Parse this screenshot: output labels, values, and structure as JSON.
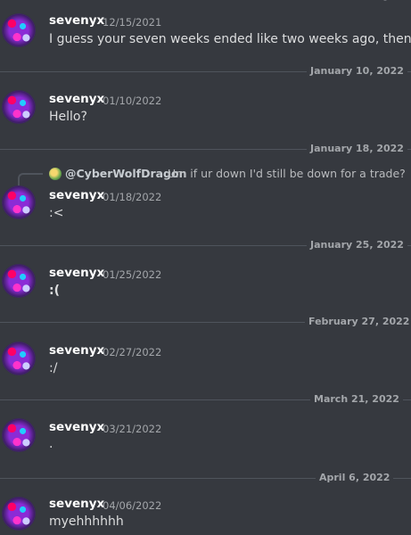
{
  "messages": [
    {
      "username": "sevenyx",
      "timestamp": "12/15/2021",
      "content": "I guess your seven weeks ended like two weeks ago, then :<"
    },
    {
      "username": "sevenyx",
      "timestamp": "01/10/2022",
      "content": "Hello?"
    },
    {
      "username": "sevenyx",
      "timestamp": "01/18/2022",
      "content": ":<"
    },
    {
      "username": "sevenyx",
      "timestamp": "01/25/2022",
      "content": ":("
    },
    {
      "username": "sevenyx",
      "timestamp": "02/27/2022",
      "content": ":/"
    },
    {
      "username": "sevenyx",
      "timestamp": "03/21/2022",
      "content": "."
    },
    {
      "username": "sevenyx",
      "timestamp": "04/06/2022",
      "content": "myehhhhhh"
    }
  ],
  "dividers": [
    "January 10, 2022",
    "January 18, 2022",
    "January 25, 2022",
    "February 27, 2022",
    "March 21, 2022",
    "April 6, 2022"
  ],
  "reply": {
    "user": "@CyberWolfDragon",
    "text": "Um if ur down I'd still be down for a trade?",
    "avatar_icon": "reply-avatar-icon"
  },
  "colors": {
    "background": "#36393f",
    "username": "#ffffff",
    "text": "#dcddde",
    "muted": "#a3a6aa",
    "divider": "#4f545c"
  }
}
